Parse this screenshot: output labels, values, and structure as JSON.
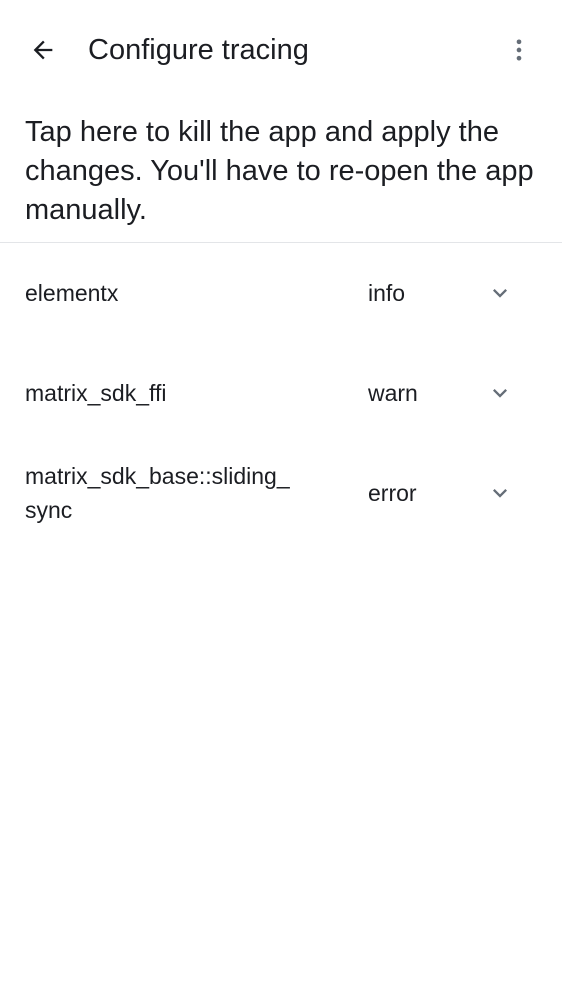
{
  "header": {
    "title": "Configure tracing",
    "back_icon": "arrow-left-icon",
    "menu_icon": "more-vertical-icon"
  },
  "banner": {
    "text": "Tap here to kill the app and apply the changes. You'll have to re-open the app manually."
  },
  "targets": [
    {
      "name": "elementx",
      "level": "info"
    },
    {
      "name": "matrix_sdk_ffi",
      "level": "warn"
    },
    {
      "name": "matrix_sdk_base::sliding_\nsync",
      "level": "error"
    }
  ],
  "colors": {
    "text": "#1b1d22",
    "icon": "#656d77",
    "divider": "#e3e5e8",
    "background": "#ffffff"
  }
}
